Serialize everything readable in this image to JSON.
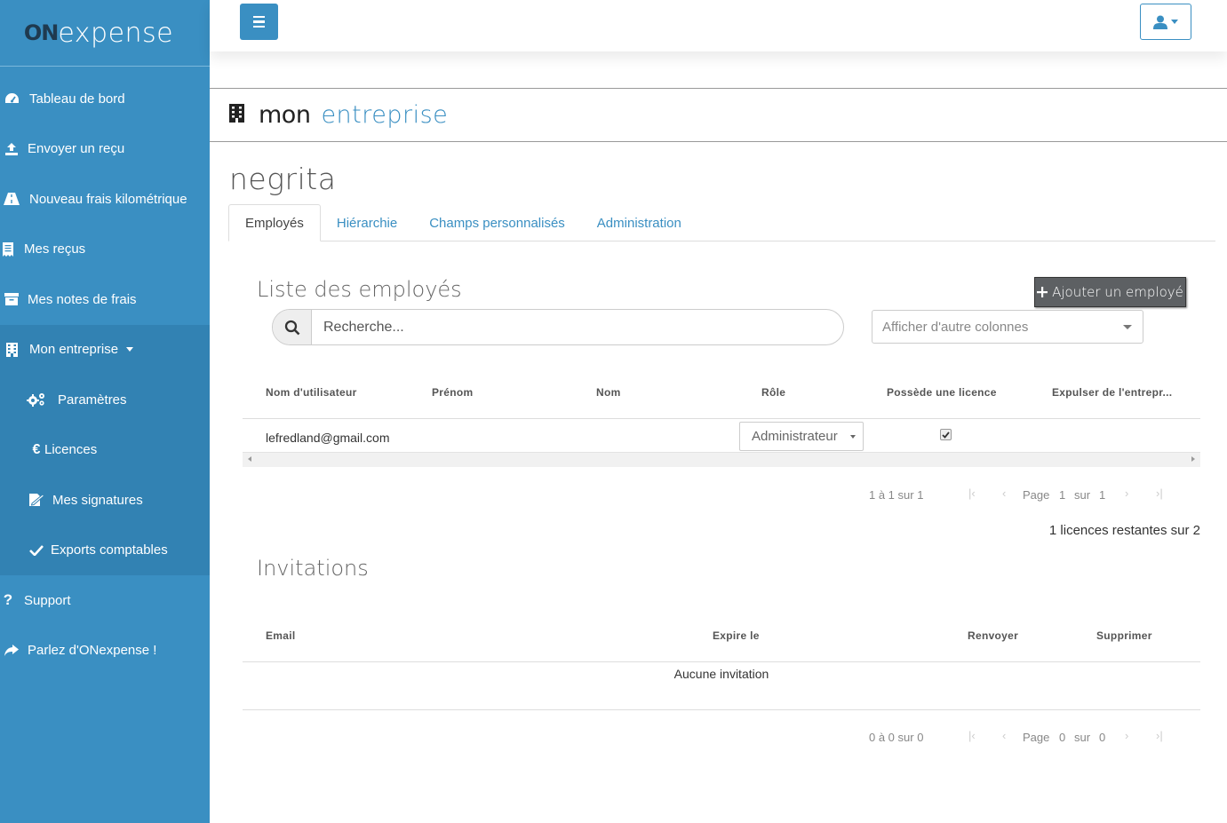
{
  "app": {
    "logo_on": "ON",
    "logo_expense": "expense"
  },
  "sidebar": {
    "items": [
      {
        "label": "Tableau de bord"
      },
      {
        "label": "Envoyer un reçu"
      },
      {
        "label": "Nouveau frais kilométrique"
      },
      {
        "label": "Mes reçus"
      },
      {
        "label": "Mes notes de frais"
      },
      {
        "label": "Mon entreprise"
      },
      {
        "label": "Paramètres"
      },
      {
        "label": "Licences"
      },
      {
        "label": "Mes signatures"
      },
      {
        "label": "Exports comptables"
      },
      {
        "label": "Support"
      },
      {
        "label": "Parlez d'ONexpense !"
      }
    ]
  },
  "header": {
    "title_part1": "mon",
    "title_part2": "entreprise"
  },
  "company_name": "negrita",
  "tabs": [
    {
      "label": "Employés",
      "active": true
    },
    {
      "label": "Hiérarchie",
      "active": false
    },
    {
      "label": "Champs personnalisés",
      "active": false
    },
    {
      "label": "Administration",
      "active": false
    }
  ],
  "employees": {
    "title": "Liste des employés",
    "add_label": "Ajouter un employé",
    "search_placeholder": "Recherche...",
    "columns_select": "Afficher d'autre colonnes",
    "headers": [
      "Nom d'utilisateur",
      "Prénom",
      "Nom",
      "Rôle",
      "Possède une licence",
      "Expulser de l'entrepr..."
    ],
    "rows": [
      {
        "username": "lefredland@gmail.com",
        "firstname": "",
        "lastname": "",
        "role": "Administrateur",
        "has_license": true
      }
    ],
    "pager": {
      "range": "1 à 1 sur 1",
      "page_label": "Page",
      "page": "1",
      "of_label": "sur",
      "total": "1"
    },
    "licenses_text": "1 licences restantes sur 2"
  },
  "invitations": {
    "title": "Invitations",
    "headers": [
      "Email",
      "Expire le",
      "Renvoyer",
      "Supprimer"
    ],
    "empty_text": "Aucune invitation",
    "pager": {
      "range": "0 à 0 sur 0",
      "page_label": "Page",
      "page": "0",
      "of_label": "sur",
      "total": "0"
    }
  },
  "colors": {
    "sidebar": "#3a8fc2",
    "sidebar_sub": "#3282b3",
    "accent": "#3a8fc2",
    "add_button": "#5d6063"
  }
}
